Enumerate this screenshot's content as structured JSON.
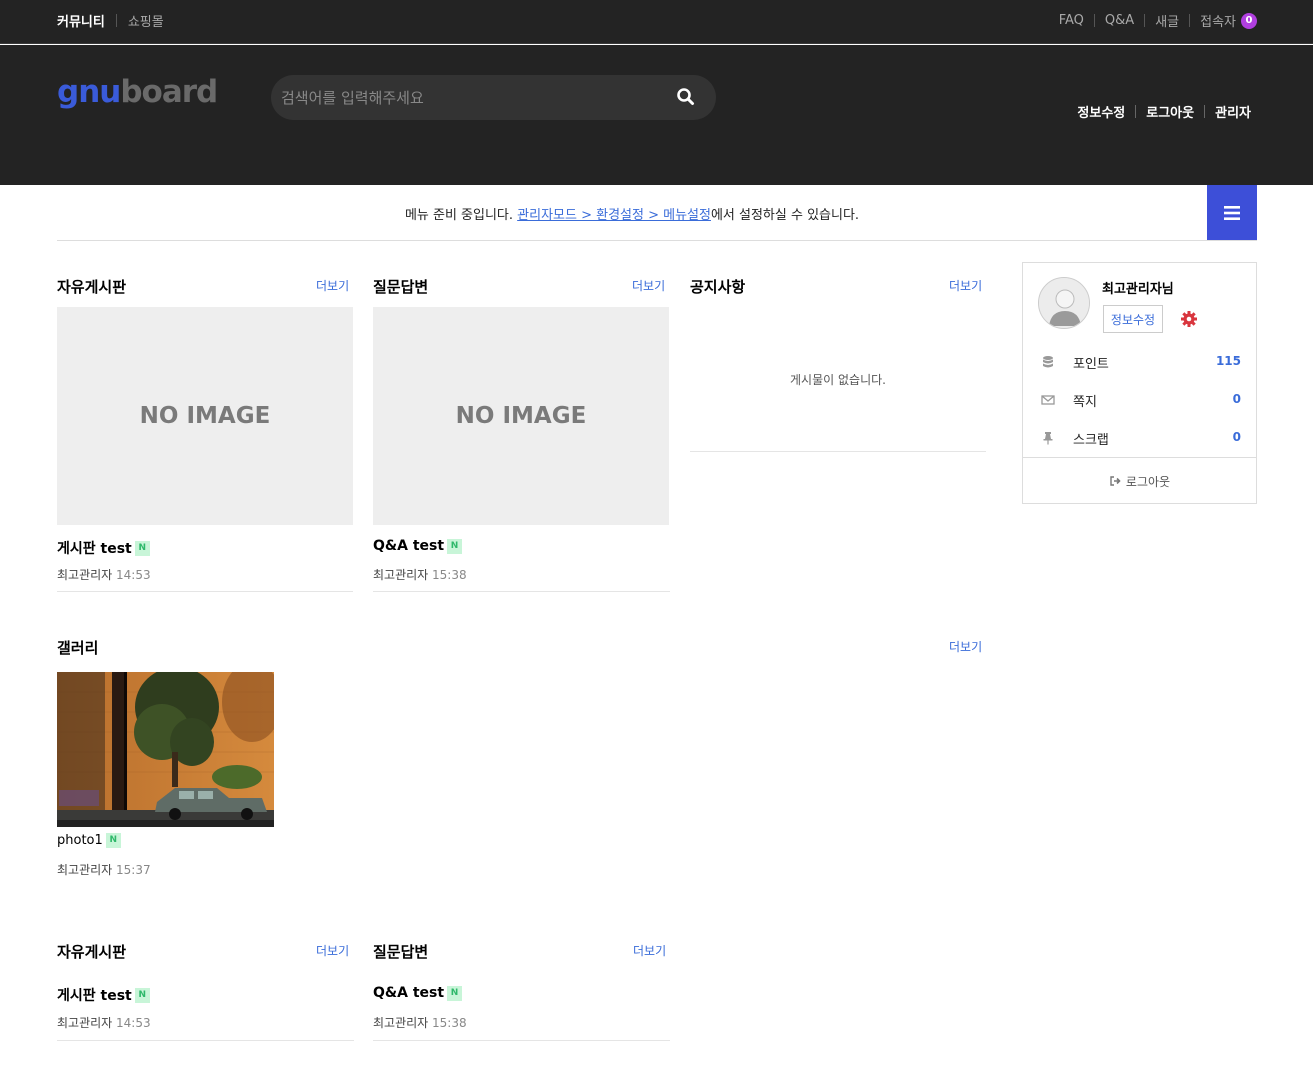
{
  "topbar": {
    "left": [
      "커뮤니티",
      "쇼핑몰"
    ],
    "right": [
      "FAQ",
      "Q&A",
      "새글",
      "접속자"
    ],
    "visitor_count": "0"
  },
  "header": {
    "logo_part1": "gnu",
    "logo_part2": "board",
    "search_placeholder": "검색어를 입력해주세요",
    "menu": [
      "정보수정",
      "로그아웃",
      "관리자"
    ]
  },
  "notice": {
    "prefix": "메뉴 준비 중입니다. ",
    "link": "관리자모드 > 환경설정 > 메뉴설정",
    "suffix": "에서 설정하실 수 있습니다."
  },
  "more_label": "더보기",
  "no_image_label": "NO IMAGE",
  "new_badge": "N",
  "widgets_top": [
    {
      "title": "자유게시판",
      "post": "게시판 test",
      "author": "최고관리자",
      "time": "14:53"
    },
    {
      "title": "질문답변",
      "post": "Q&A test",
      "author": "최고관리자",
      "time": "15:38"
    },
    {
      "title": "공지사항",
      "empty": "게시물이 없습니다."
    }
  ],
  "gallery": {
    "title": "갤러리",
    "post": "photo1",
    "author": "최고관리자",
    "time": "15:37"
  },
  "widgets_bottom": [
    {
      "title": "자유게시판",
      "post": "게시판 test",
      "author": "최고관리자",
      "time": "14:53"
    },
    {
      "title": "질문답변",
      "post": "Q&A test",
      "author": "최고관리자",
      "time": "15:38"
    }
  ],
  "profile": {
    "name": "최고관리자님",
    "edit": "정보수정",
    "rows": [
      {
        "icon": "database-icon",
        "label": "포인트",
        "value": "115"
      },
      {
        "icon": "envelope-icon",
        "label": "쪽지",
        "value": "0"
      },
      {
        "icon": "pin-icon",
        "label": "스크랩",
        "value": "0"
      }
    ],
    "logout": "로그아웃"
  },
  "colors": {
    "dark_bg": "#232323",
    "accent": "#3d4fd8",
    "link": "#3a6cd9",
    "badge_purple": "#b13fe0"
  }
}
